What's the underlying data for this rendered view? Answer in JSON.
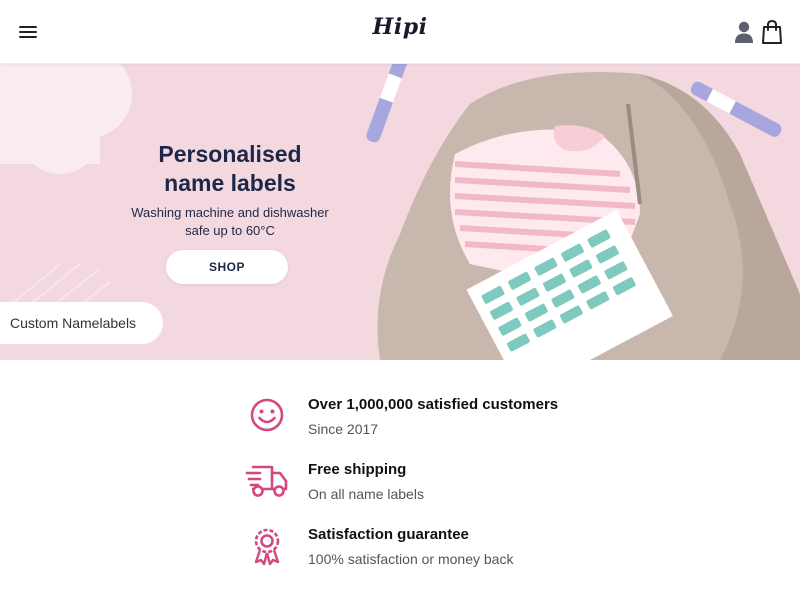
{
  "header": {
    "logo_text": "Hipi",
    "icons": [
      "menu-icon",
      "account-icon",
      "shopping-bag-icon"
    ]
  },
  "hero": {
    "title": "Personalised name labels",
    "subtitle": "Washing machine and dishwasher safe up to 60°C",
    "shop_label": "SHOP",
    "chip_label": "Custom Namelabels"
  },
  "features": [
    {
      "icon": "smiley-icon",
      "title": "Over 1,000,000 satisfied customers",
      "subtitle": "Since 2017"
    },
    {
      "icon": "delivery-truck-icon",
      "title": "Free shipping",
      "subtitle": "On all name labels"
    },
    {
      "icon": "award-ribbon-icon",
      "title": "Satisfaction guarantee",
      "subtitle": "100% satisfaction or money back"
    }
  ],
  "colors": {
    "accent": "#d4477f",
    "hero_bg": "#f3d9df",
    "heading": "#1f2748"
  }
}
